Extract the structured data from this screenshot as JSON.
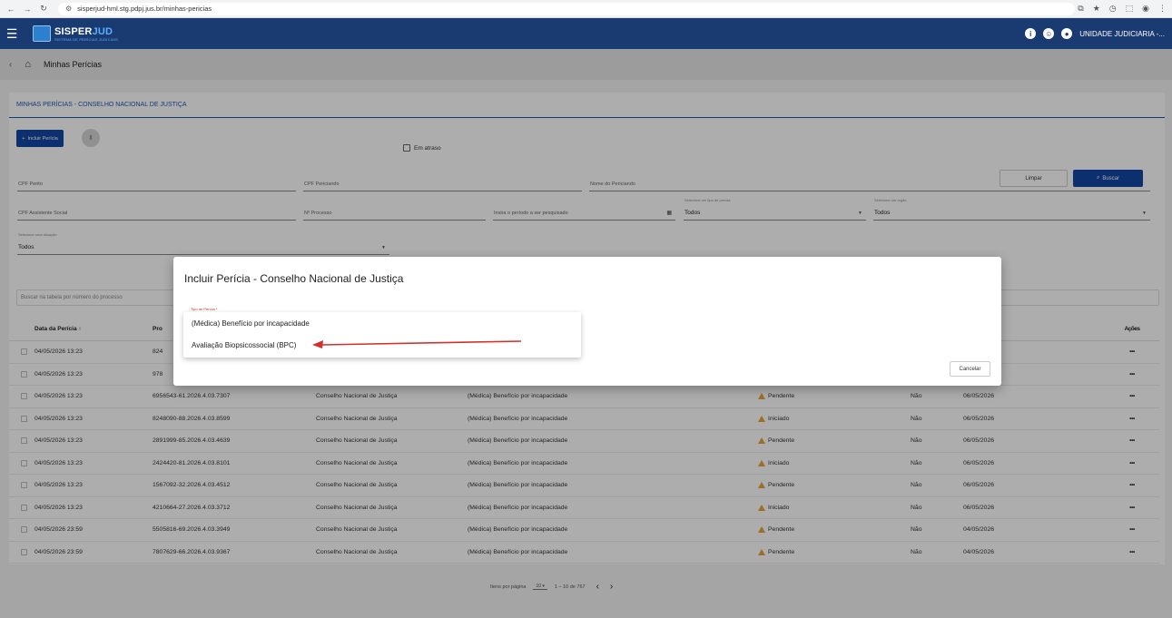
{
  "browser": {
    "url": "sisperjud-hml.stg.pdpj.jus.br/minhas-pericias"
  },
  "header": {
    "logo_main": "SISPER",
    "logo_accent": "JUD",
    "logo_sub": "SISTEMA DE PERÍCIAS JUDICIAIS",
    "unit": "UNIDADE JUDICIARIA -..."
  },
  "breadcrumb": {
    "title": "Minhas Perícias"
  },
  "card": {
    "title": "MINHAS PERÍCIAS - CONSELHO NACIONAL DE JUSTIÇA",
    "incluir_label": "Incluir Perícia"
  },
  "filters": {
    "cpf_perito": "CPF Perito",
    "cpf_periciando": "CPF Periciando",
    "nome_periciando": "Nome do Periciando",
    "cpf_assistente": "CPF Assistente Social",
    "num_processo": "Nº Processo",
    "periodo": "Insira o período a ser pesquisado",
    "tipo_label": "Selecione um tipo de perícia",
    "tipo_value": "Todos",
    "orgao_label": "Selecione um órgão",
    "orgao_value": "Todos",
    "situacao_label": "Selecione uma situação",
    "situacao_value": "Todos",
    "em_atraso": "Em atraso",
    "limpar": "Limpar",
    "buscar": "Buscar",
    "search_table": "Buscar na tabela por número do processo"
  },
  "table": {
    "headers": {
      "data": "Data da Perícia ↑",
      "proc": "Pro",
      "prazo": "o do laudo",
      "acoes": "Ações"
    },
    "rows": [
      {
        "data": "04/05/2026 13:23",
        "proc": "824",
        "org": "",
        "tipo": "",
        "sit": "",
        "atr": "",
        "prazo": "",
        "acoes": "•••"
      },
      {
        "data": "04/05/2026 13:23",
        "proc": "978",
        "org": "",
        "tipo": "",
        "sit": "",
        "atr": "",
        "prazo": "",
        "acoes": "•••"
      },
      {
        "data": "04/05/2026 13:23",
        "proc": "6956543-61.2026.4.03.7307",
        "org": "Conselho Nacional de Justiça",
        "tipo": "(Médica) Benefício por incapacidade",
        "sit": "Pendente",
        "atr": "Não",
        "prazo": "06/05/2026",
        "acoes": "•••"
      },
      {
        "data": "04/05/2026 13:23",
        "proc": "8248090-88.2026.4.03.8599",
        "org": "Conselho Nacional de Justiça",
        "tipo": "(Médica) Benefício por incapacidade",
        "sit": "Iniciado",
        "atr": "Não",
        "prazo": "06/05/2026",
        "acoes": "•••"
      },
      {
        "data": "04/05/2026 13:23",
        "proc": "2891999-85.2026.4.03.4639",
        "org": "Conselho Nacional de Justiça",
        "tipo": "(Médica) Benefício por incapacidade",
        "sit": "Pendente",
        "atr": "Não",
        "prazo": "06/05/2026",
        "acoes": "•••"
      },
      {
        "data": "04/05/2026 13:23",
        "proc": "2424420-81.2026.4.03.8101",
        "org": "Conselho Nacional de Justiça",
        "tipo": "(Médica) Benefício por incapacidade",
        "sit": "Iniciado",
        "atr": "Não",
        "prazo": "06/05/2026",
        "acoes": "•••"
      },
      {
        "data": "04/05/2026 13:23",
        "proc": "1567092-32.2026.4.03.4512",
        "org": "Conselho Nacional de Justiça",
        "tipo": "(Médica) Benefício por incapacidade",
        "sit": "Pendente",
        "atr": "Não",
        "prazo": "06/05/2026",
        "acoes": "•••"
      },
      {
        "data": "04/05/2026 13:23",
        "proc": "4210664-27.2026.4.03.3712",
        "org": "Conselho Nacional de Justiça",
        "tipo": "(Médica) Benefício por incapacidade",
        "sit": "Iniciado",
        "atr": "Não",
        "prazo": "06/05/2026",
        "acoes": "•••"
      },
      {
        "data": "04/05/2026 23:59",
        "proc": "5505816-69.2026.4.03.3949",
        "org": "Conselho Nacional de Justiça",
        "tipo": "(Médica) Benefício por incapacidade",
        "sit": "Pendente",
        "atr": "Não",
        "prazo": "04/05/2026",
        "acoes": "•••"
      },
      {
        "data": "04/05/2026 23:59",
        "proc": "7807629-66.2026.4.03.9367",
        "org": "Conselho Nacional de Justiça",
        "tipo": "(Médica) Benefício por incapacidade",
        "sit": "Pendente",
        "atr": "Não",
        "prazo": "04/05/2026",
        "acoes": "•••"
      }
    ]
  },
  "pager": {
    "items_label": "Itens por página",
    "size": "10",
    "range": "1 – 10 de 767"
  },
  "dialog": {
    "title": "Incluir Perícia - Conselho Nacional de Justiça",
    "field_label": "Tipo de Perícia *",
    "options": [
      "(Médica) Benefício por incapacidade",
      "Avaliação Biopsicossocial (BPC)"
    ],
    "cancel": "Cancelar"
  },
  "colors": {
    "header_bg": "#1a3a72",
    "primary": "#1346a6",
    "warning": "#e8a23c",
    "annotation": "#d32f2f"
  }
}
